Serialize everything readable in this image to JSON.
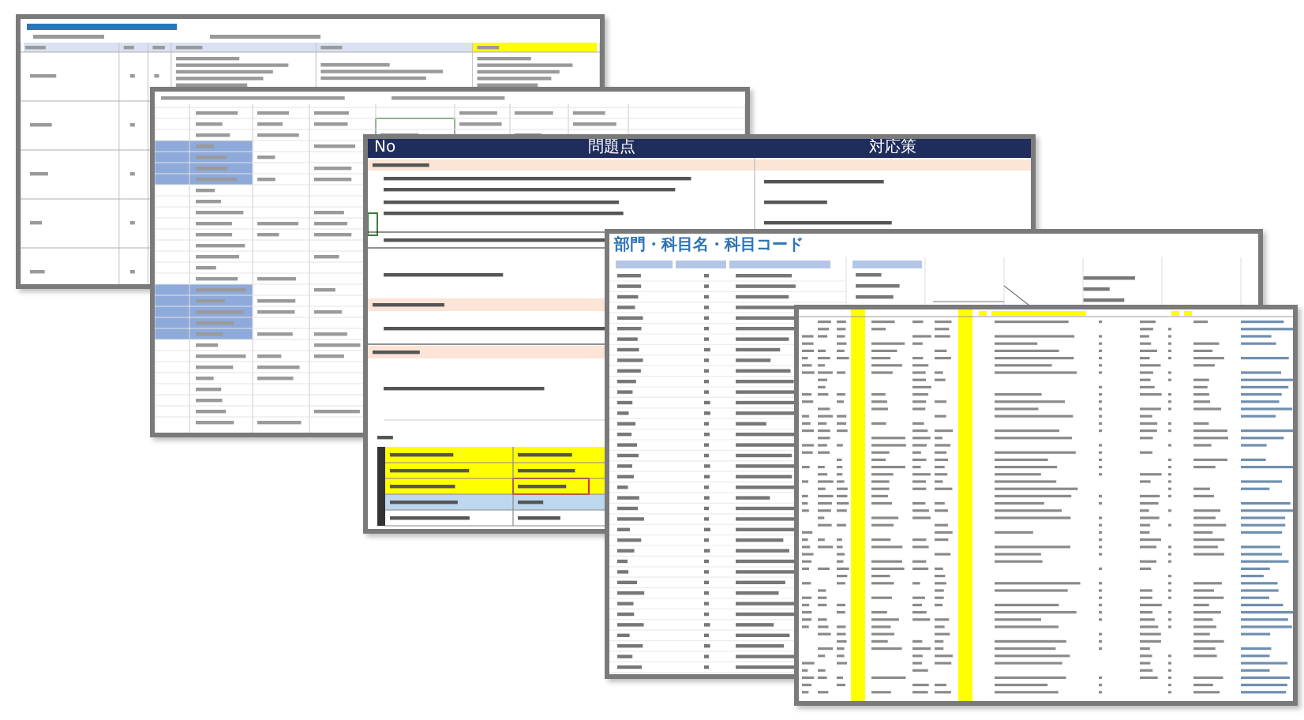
{
  "sheets": [
    {
      "kind": "issue-table"
    },
    {
      "kind": "ledger"
    },
    {
      "kind": "issue-list",
      "columns": [
        "No",
        "問題点",
        "対応策"
      ]
    },
    {
      "kind": "code-list",
      "title": "部門・科目名・科目コード"
    },
    {
      "kind": "data-dump"
    }
  ]
}
